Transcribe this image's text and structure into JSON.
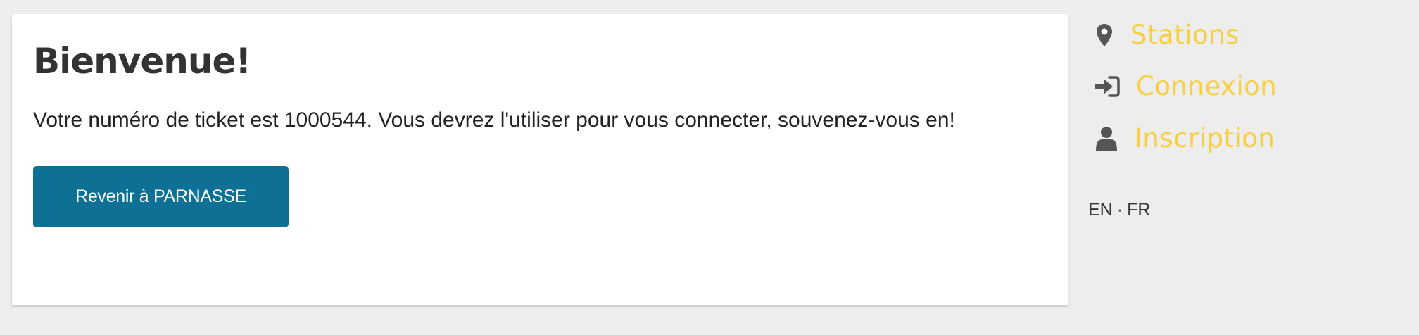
{
  "main": {
    "heading": "Bienvenue!",
    "message": "Votre numéro de ticket est 1000544. Vous devrez l'utiliser pour vous connecter, souvenez-vous en!",
    "back_button_label": "Revenir à PARNASSE"
  },
  "sidebar": {
    "links": [
      {
        "label": "Stations",
        "icon": "map-marker-icon"
      },
      {
        "label": "Connexion",
        "icon": "sign-in-icon"
      },
      {
        "label": "Inscription",
        "icon": "user-icon"
      }
    ],
    "languages": {
      "en": "EN",
      "separator": "·",
      "fr": "FR"
    }
  },
  "colors": {
    "background": "#ededed",
    "card": "#ffffff",
    "button": "#0f7095",
    "link": "#f7cf3f",
    "icon": "#555555",
    "text": "#333333"
  }
}
